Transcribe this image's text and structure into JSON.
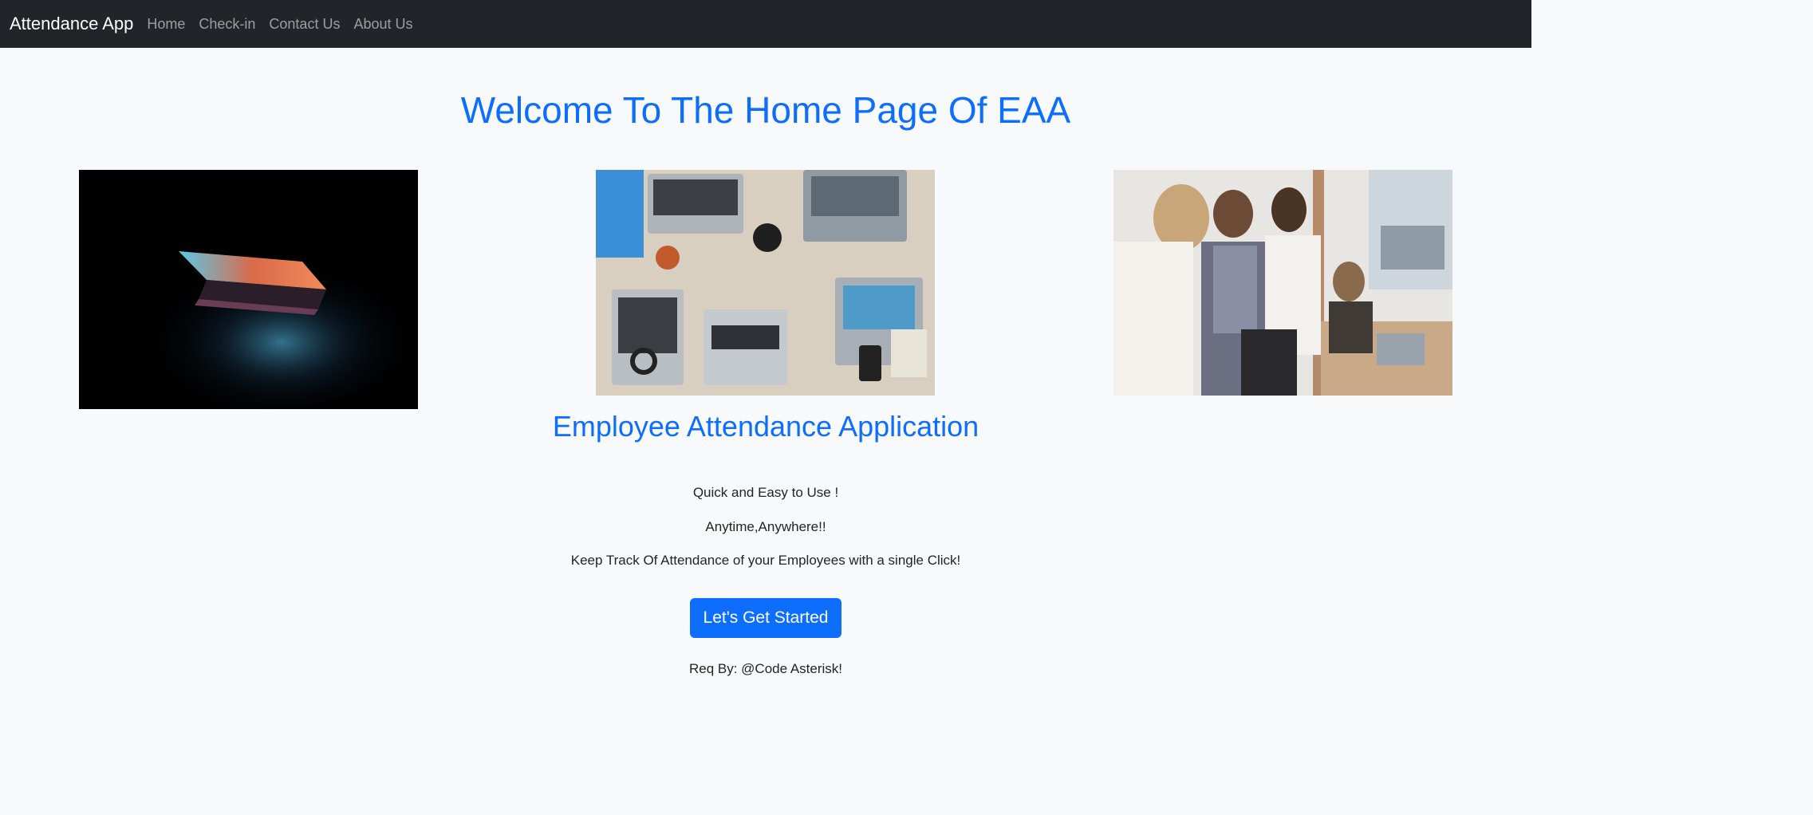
{
  "navbar": {
    "brand": "Attendance App",
    "links": [
      "Home",
      "Check-in",
      "Contact Us",
      "About Us"
    ]
  },
  "hero": {
    "title": "Welcome To The Home Page Of EAA"
  },
  "images": [
    {
      "name": "laptop-photo"
    },
    {
      "name": "workspace-photo"
    },
    {
      "name": "team-photo"
    }
  ],
  "content": {
    "subtitle": "Employee Attendance Application",
    "line1": "Quick and Easy to Use !",
    "line2": "Anytime,Anywhere!!",
    "line3": "Keep Track Of Attendance of your Employees with a single Click!",
    "button": "Let's Get Started",
    "credit": "Req By: @Code Asterisk!"
  },
  "colors": {
    "navbar_bg": "#212529",
    "accent": "#0d6efd",
    "page_bg": "#f8f9fa"
  }
}
